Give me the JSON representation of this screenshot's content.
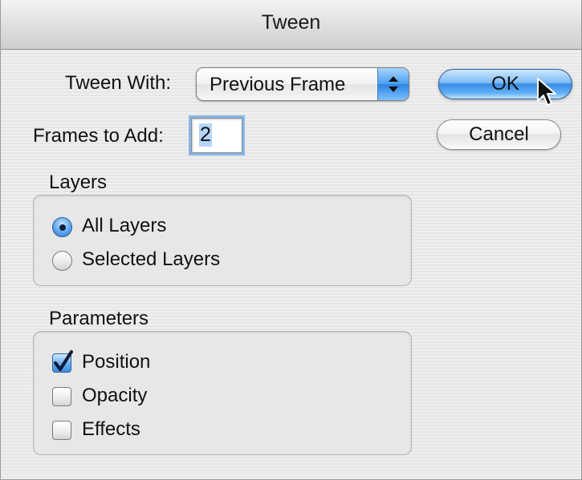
{
  "window": {
    "title": "Tween"
  },
  "tween_with": {
    "label": "Tween With:",
    "selected": "Previous Frame"
  },
  "frames_to_add": {
    "label": "Frames to Add:",
    "value": "2"
  },
  "buttons": {
    "ok": "OK",
    "cancel": "Cancel"
  },
  "layers": {
    "heading": "Layers",
    "options": [
      {
        "label": "All Layers",
        "selected": true
      },
      {
        "label": "Selected Layers",
        "selected": false
      }
    ]
  },
  "parameters": {
    "heading": "Parameters",
    "options": [
      {
        "label": "Position",
        "checked": true
      },
      {
        "label": "Opacity",
        "checked": false
      },
      {
        "label": "Effects",
        "checked": false
      }
    ]
  },
  "colors": {
    "accent": "#3a8ee6",
    "titlebar": "#dedede",
    "background": "#ececec"
  },
  "icons": {
    "popup": "up-down-arrows-icon",
    "check": "checkmark-icon",
    "cursor": "mouse-pointer-icon"
  }
}
